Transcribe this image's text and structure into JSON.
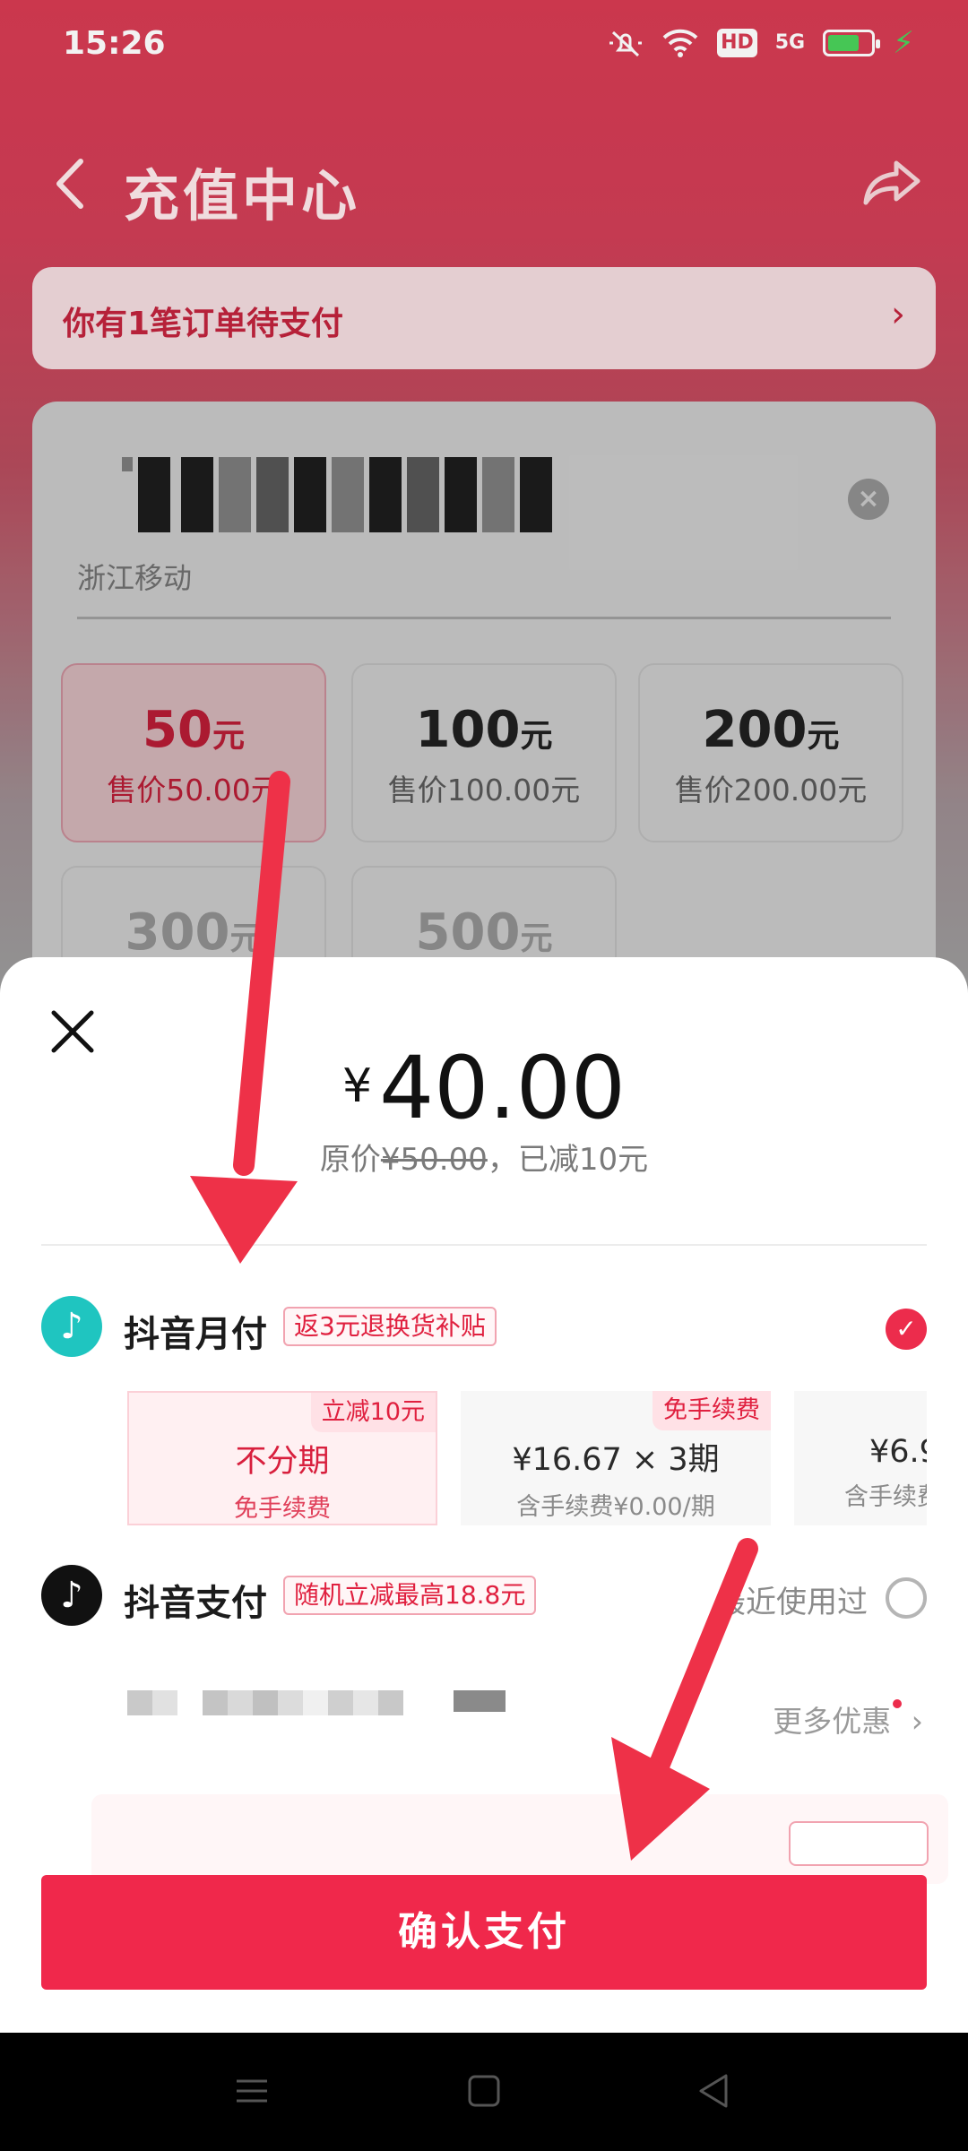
{
  "status_bar": {
    "time": "15:26",
    "icons": [
      "mute-icon",
      "wifi-icon",
      "hd-icon",
      "5g-signal-icon",
      "battery-icon"
    ],
    "hd_label": "HD",
    "net_label": "5G"
  },
  "nav": {
    "title": "充值中心",
    "back_icon": "back-chevron-icon",
    "share_icon": "share-icon"
  },
  "pending": {
    "text": "你有1笔订单待支付"
  },
  "recharge": {
    "carrier": "浙江移动",
    "options": [
      {
        "amount": "50",
        "unit": "元",
        "price": "售价50.00元",
        "selected": true
      },
      {
        "amount": "100",
        "unit": "元",
        "price": "售价100.00元",
        "selected": false
      },
      {
        "amount": "200",
        "unit": "元",
        "price": "售价200.00元",
        "selected": false
      },
      {
        "amount": "300",
        "unit": "元",
        "price": "",
        "selected": false
      },
      {
        "amount": "500",
        "unit": "元",
        "price": "",
        "selected": false
      }
    ]
  },
  "sheet": {
    "currency": "¥",
    "amount": "40.00",
    "orig_prefix": "原价",
    "orig_price": "¥50.00",
    "orig_suffix": "，已减10元",
    "methods": [
      {
        "name": "抖音月付",
        "tag": "返3元退换货补贴",
        "selected": true
      },
      {
        "name": "抖音支付",
        "tag": "随机立减最高18.8元",
        "note": "最近使用过",
        "selected": false
      }
    ],
    "plans": [
      {
        "badge": "立减10元",
        "main": "不分期",
        "sub": "免手续费",
        "selected": true
      },
      {
        "badge": "免手续费",
        "main": "¥16.67 × 3期",
        "sub": "含手续费¥0.00/期",
        "selected": false
      },
      {
        "badge": "",
        "main": "¥6.9",
        "sub": "含手续费",
        "selected": false
      }
    ],
    "more_offers": "更多优惠",
    "confirm": "确认支付"
  },
  "colors": {
    "accent": "#f0284b",
    "header_red": "#d63a52",
    "tag_red": "#e0203f"
  }
}
